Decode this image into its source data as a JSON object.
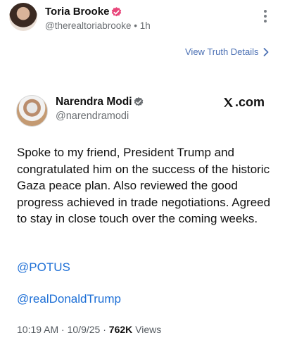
{
  "post": {
    "author_name": "Toria Brooke",
    "author_handle": "@therealtoriabrooke",
    "separator": " • ",
    "time_ago": "1h",
    "details_link": "View Truth Details"
  },
  "embed": {
    "author_name": "Narendra Modi",
    "author_handle": "@narendramodi",
    "source": ".com",
    "text": "Spoke to my friend, President Trump and congratulated him on the success of the historic Gaza peace plan. Also reviewed the good progress achieved in trade negotiations. Agreed to stay in close touch over the coming weeks.",
    "mention_1": "@POTUS",
    "mention_2": "@realDonaldTrump",
    "time": "10:19 AM",
    "dot": " · ",
    "date": "10/9/25",
    "views_count": "762K",
    "views_label": " Views"
  },
  "colors": {
    "verified_pink": "#e8467a",
    "verified_blue": "#1d9bf0",
    "link_blue": "#4a6fb3",
    "mention_blue": "#1d6fd6"
  },
  "icons": {
    "verified": "verified-badge-icon",
    "more": "more-vertical-icon",
    "chevron": "chevron-right-icon",
    "x_logo": "x-logo-icon"
  }
}
